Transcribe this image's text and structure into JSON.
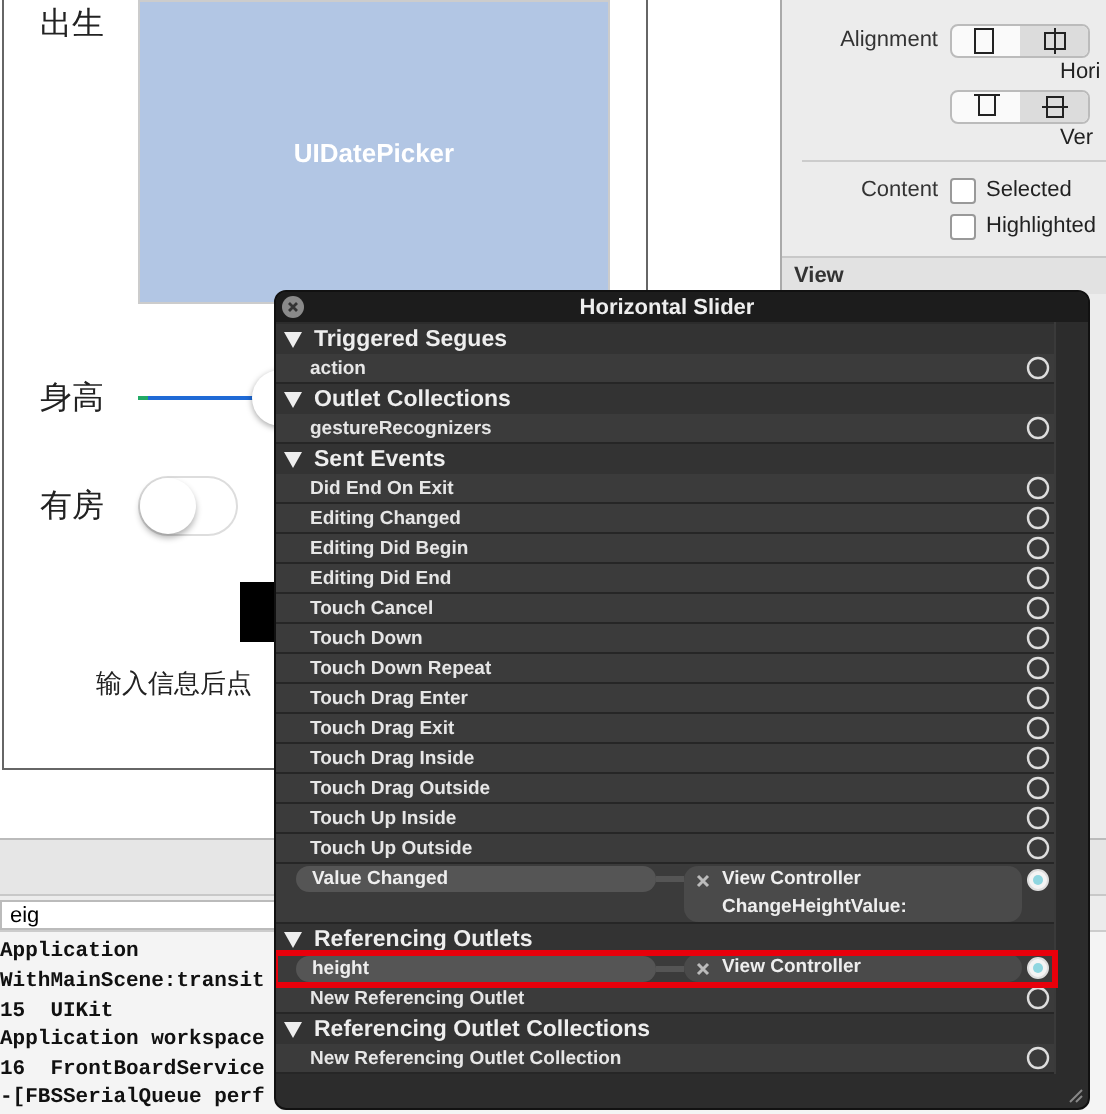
{
  "scene": {
    "rows": [
      {
        "kind": "datepicker",
        "label": "出生",
        "text": "UIDatePicker"
      },
      {
        "kind": "slider",
        "label": "身高",
        "level": 0.3
      },
      {
        "kind": "switch",
        "label": "有房",
        "on": false
      }
    ],
    "hint": "输入信息后点"
  },
  "inspector": {
    "alignment_label": "Alignment",
    "horizontal_segments": [
      {
        "kind": "left",
        "selected": false
      },
      {
        "kind": "center",
        "selected": true
      }
    ],
    "horizontal_caption": "Hori",
    "vertical_segments": [
      {
        "kind": "top",
        "selected": false
      },
      {
        "kind": "middle",
        "selected": true
      }
    ],
    "vertical_caption": "Ver",
    "content_label": "Content",
    "checkboxes": [
      {
        "label": "Selected",
        "checked": false
      },
      {
        "label": "Highlighted",
        "checked": false
      }
    ],
    "section": "View"
  },
  "debug": {
    "search": {
      "value": "eig"
    },
    "console": [
      "Application",
      "WithMainScene:transit",
      "15  UIKit",
      "Application workspace",
      "16  FrontBoardService",
      "-[FBSSerialQueue perf"
    ]
  },
  "hud": {
    "title": "Horizontal Slider",
    "sections": [
      {
        "title": "Triggered Segues",
        "expanded": true,
        "items": [
          {
            "name": "action",
            "connected": false,
            "highlighted": false
          }
        ]
      },
      {
        "title": "Outlet Collections",
        "expanded": true,
        "items": [
          {
            "name": "gestureRecognizers",
            "connected": false,
            "highlighted": false
          }
        ]
      },
      {
        "title": "Sent Events",
        "expanded": true,
        "items": [
          {
            "name": "Did End On Exit",
            "connected": false,
            "highlighted": false
          },
          {
            "name": "Editing Changed",
            "connected": false,
            "highlighted": false
          },
          {
            "name": "Editing Did Begin",
            "connected": false,
            "highlighted": false
          },
          {
            "name": "Editing Did End",
            "connected": false,
            "highlighted": false
          },
          {
            "name": "Touch Cancel",
            "connected": false,
            "highlighted": false
          },
          {
            "name": "Touch Down",
            "connected": false,
            "highlighted": false
          },
          {
            "name": "Touch Down Repeat",
            "connected": false,
            "highlighted": false
          },
          {
            "name": "Touch Drag Enter",
            "connected": false,
            "highlighted": false
          },
          {
            "name": "Touch Drag Exit",
            "connected": false,
            "highlighted": false
          },
          {
            "name": "Touch Drag Inside",
            "connected": false,
            "highlighted": false
          },
          {
            "name": "Touch Drag Outside",
            "connected": false,
            "highlighted": false
          },
          {
            "name": "Touch Up Inside",
            "connected": false,
            "highlighted": false
          },
          {
            "name": "Touch Up Outside",
            "connected": false,
            "highlighted": false
          },
          {
            "name": "Value Changed",
            "connected": true,
            "highlighted": false,
            "target": "View Controller",
            "action": "ChangeHeightValue:"
          }
        ]
      },
      {
        "title": "Referencing Outlets",
        "expanded": true,
        "items": [
          {
            "name": "height",
            "connected": true,
            "highlighted": true,
            "target": "View Controller"
          },
          {
            "name": "New Referencing Outlet",
            "connected": false,
            "highlighted": false
          }
        ]
      },
      {
        "title": "Referencing Outlet Collections",
        "expanded": true,
        "items": [
          {
            "name": "New Referencing Outlet Collection",
            "connected": false,
            "highlighted": false
          }
        ]
      }
    ]
  }
}
